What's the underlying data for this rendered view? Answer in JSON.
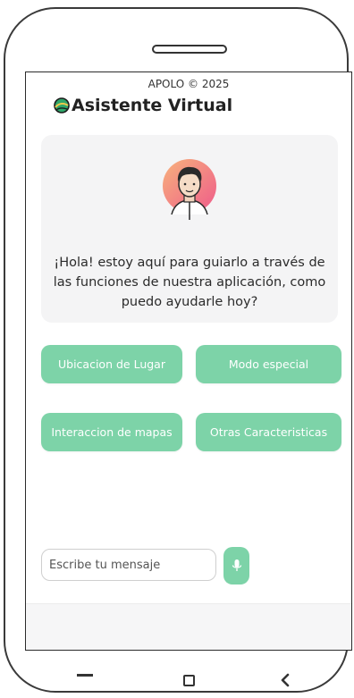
{
  "header": {
    "brand": "APOLO © 2025",
    "title": "Asistente Virtual"
  },
  "welcome": {
    "message": "¡Hola! estoy aquí para guiarlo a través de las funciones de nuestra aplicación, como puedo ayudarle hoy?"
  },
  "options": [
    {
      "label": "Ubicacion de Lugar"
    },
    {
      "label": "Modo especial"
    },
    {
      "label": "Interaccion de mapas"
    },
    {
      "label": "Otras Caracteristicas"
    }
  ],
  "input": {
    "placeholder": "Escribe tu mensaje",
    "value": ""
  },
  "colors": {
    "accent": "#7dd3a8",
    "card_bg": "#f4f4f5",
    "avatar_bg": "#f27a8c"
  },
  "icons": {
    "title": "planet-icon",
    "avatar": "user-avatar-icon",
    "send": "microphone-icon",
    "nav_back": "back-bar-icon",
    "nav_home": "square-icon",
    "nav_recent": "chevron-left-icon"
  }
}
